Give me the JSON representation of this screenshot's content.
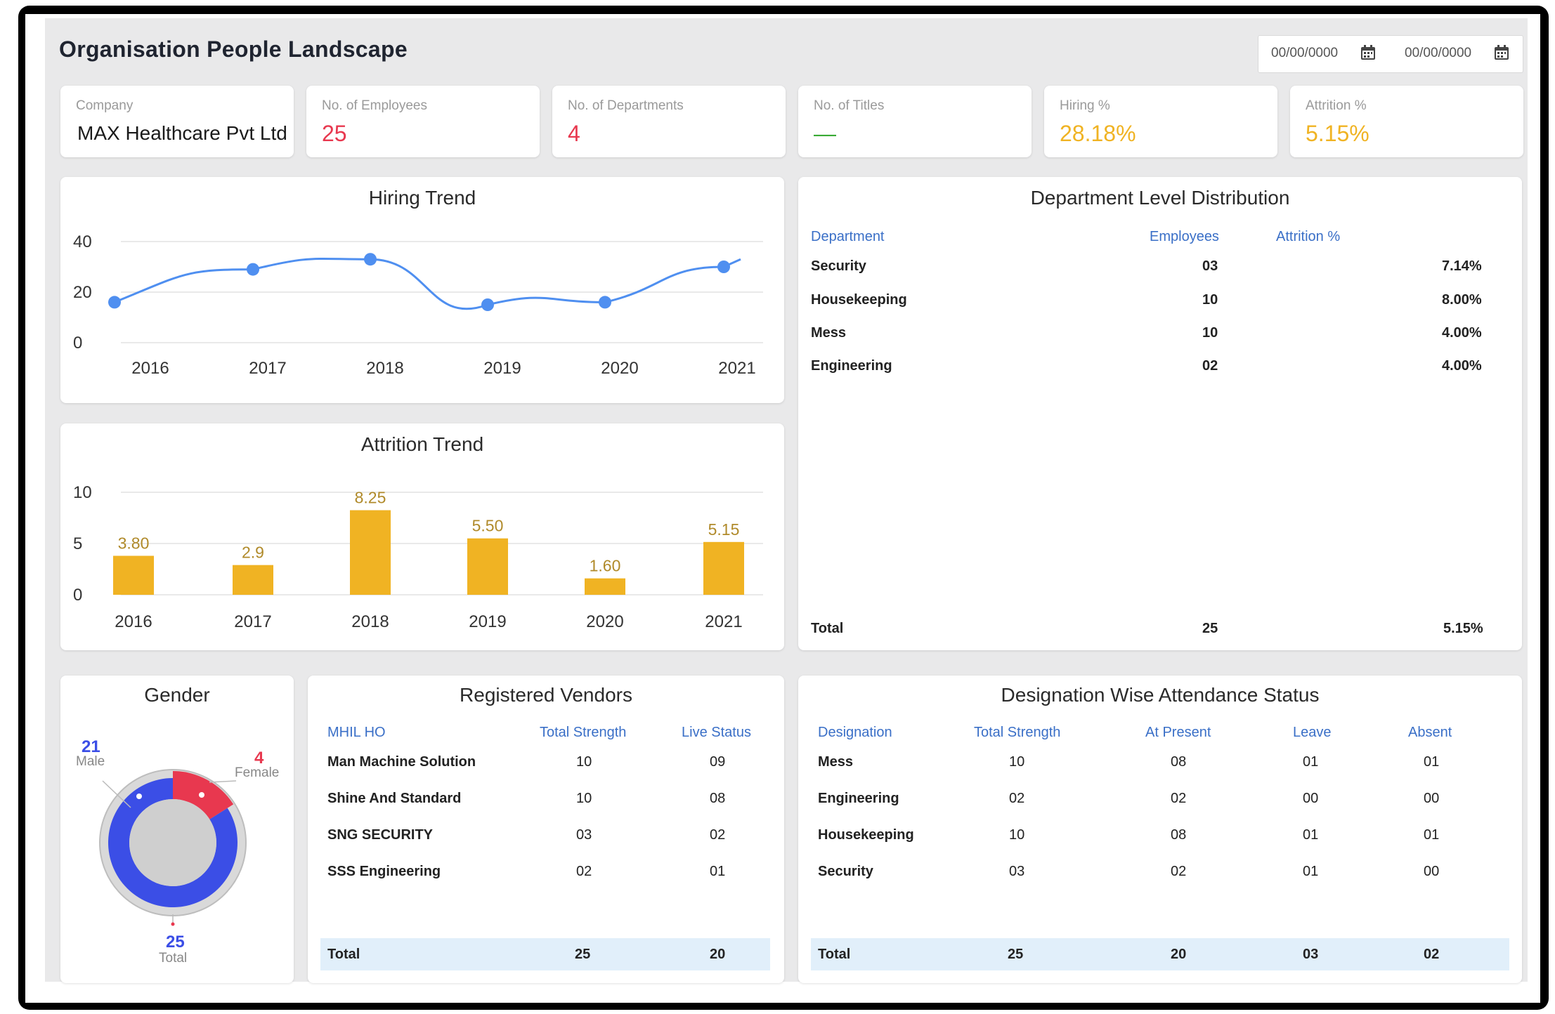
{
  "header": {
    "title": "Organisation People Landscape",
    "date_from": "00/00/0000",
    "date_to": "00/00/0000"
  },
  "kpis": [
    {
      "label": "Company",
      "value": "MAX Healthcare Pvt Ltd",
      "color": "#1a1a1a"
    },
    {
      "label": "No. of Employees",
      "value": "25",
      "color": "#e8384f"
    },
    {
      "label": "No. of Departments",
      "value": "4",
      "color": "#e8384f"
    },
    {
      "label": "No. of Titles",
      "value": "—",
      "color": "#3aaa35"
    },
    {
      "label": "Hiring %",
      "value": "28.18%",
      "color": "#f0b323"
    },
    {
      "label": "Attrition %",
      "value": "5.15%",
      "color": "#f0b323"
    }
  ],
  "hiring_trend": {
    "title": "Hiring Trend",
    "chart_data": {
      "type": "line",
      "title": "Hiring Trend",
      "categories": [
        "2016",
        "2017",
        "2018",
        "2019",
        "2020",
        "2021"
      ],
      "values": [
        16,
        29,
        33,
        15,
        16,
        30
      ],
      "ylim": [
        0,
        40
      ],
      "yticks": [
        "40",
        "20",
        "0"
      ],
      "grid": true,
      "color": "#4f8ff0"
    }
  },
  "attrition_trend": {
    "title": "Attrition Trend",
    "chart_data": {
      "type": "bar",
      "title": "Attrition Trend",
      "categories": [
        "2016",
        "2017",
        "2018",
        "2019",
        "2020",
        "2021"
      ],
      "values": [
        3.8,
        2.9,
        8.25,
        5.5,
        1.6,
        5.15
      ],
      "data_labels": [
        "3.80",
        "2.9",
        "8.25",
        "5.50",
        "1.60",
        "5.15"
      ],
      "ylim": [
        0,
        10
      ],
      "yticks": [
        "10",
        "5",
        "0"
      ],
      "grid": true,
      "color": "#f0b323",
      "label_color": "#b08a2a"
    }
  },
  "department_distribution": {
    "title": "Department Level Distribution",
    "headers": [
      "Department",
      "Employees",
      "Attrition %"
    ],
    "rows": [
      [
        "Security",
        "03",
        "7.14%"
      ],
      [
        "Housekeeping",
        "10",
        "8.00%"
      ],
      [
        "Mess",
        "10",
        "4.00%"
      ],
      [
        "Engineering",
        "02",
        "4.00%"
      ]
    ],
    "total": [
      "Total",
      "25",
      "5.15%"
    ]
  },
  "gender": {
    "title": "Gender",
    "male_count": "21",
    "male_label": "Male",
    "female_count": "4",
    "female_label": "Female",
    "total_count": "25",
    "total_label": "Total",
    "chart_data": {
      "type": "pie",
      "categories": [
        "Male",
        "Female"
      ],
      "values": [
        21,
        4
      ],
      "colors": [
        "#3b4ee6",
        "#e8384f"
      ]
    }
  },
  "vendors": {
    "title": "Registered Vendors",
    "headers": [
      "MHIL HO",
      "Total Strength",
      "Live Status"
    ],
    "rows": [
      [
        "Man Machine Solution",
        "10",
        "09"
      ],
      [
        "Shine And Standard",
        "10",
        "08"
      ],
      [
        "SNG SECURITY",
        "03",
        "02"
      ],
      [
        "SSS Engineering",
        "02",
        "01"
      ]
    ],
    "total": [
      "Total",
      "25",
      "20"
    ]
  },
  "attendance": {
    "title": "Designation Wise Attendance Status",
    "headers": [
      "Designation",
      "Total Strength",
      "At Present",
      "Leave",
      "Absent"
    ],
    "rows": [
      [
        "Mess",
        "10",
        "08",
        "01",
        "01"
      ],
      [
        "Engineering",
        "02",
        "02",
        "00",
        "00"
      ],
      [
        "Housekeeping",
        "10",
        "08",
        "01",
        "01"
      ],
      [
        "Security",
        "03",
        "02",
        "01",
        "00"
      ]
    ],
    "total": [
      "Total",
      "25",
      "20",
      "03",
      "02"
    ]
  }
}
